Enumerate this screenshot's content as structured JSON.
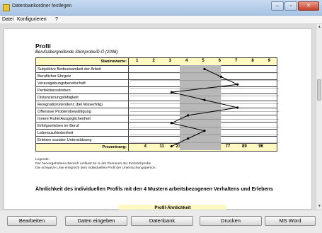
{
  "window": {
    "title": "Datenbankordner festlegen",
    "controls": [
      "–",
      "▫",
      "✕"
    ]
  },
  "menu": [
    "Datei",
    "Konfigurieren",
    "?"
  ],
  "report": {
    "heading": "Profil",
    "subheading": "Berufsübergreifende Stichprobe/D-Ö (2008)",
    "stanine_label": "Staninewerte:",
    "stanine_values": [
      "1",
      "2",
      "3",
      "4",
      "5",
      "6",
      "7",
      "8",
      "9"
    ],
    "percentile_label": "Prozentrang:",
    "percentile_values": [
      "4",
      "11",
      "23",
      "40",
      "60",
      "77",
      "89",
      "96"
    ],
    "rows": [
      "Subjektive Bedeutsamkeit der Arbeit",
      "Beruflicher Ehrgeiz",
      "Verausgabungsbereitschaft",
      "Perfektionsstreben",
      "Distanzierungsfähigkeit",
      "Resignationstendenz (bei Misserfolg)",
      "Offensive Problembewältigung",
      "Innere Ruhe/Ausgeglichenheit",
      "Erfolgserleben im Beruf",
      "Lebenszufriedenheit",
      "Erleben sozialer Unterstützung"
    ],
    "legend": [
      "Legende:",
      "Der hervorgehobene Bereich umfasst 54 % der Personen der Eichstichprobe.",
      "Die schwarze Linie entspricht dem individuellen Profil der Untersuchungsperson."
    ],
    "similarity_heading": "Ähnlichkeit des individuellen Profils mit den 4 Mustern arbeitsbezogenen Verhaltens und Erlebens",
    "similarity_box": "Profil-Ähnlichkeit"
  },
  "chart_data": {
    "type": "line",
    "title": "Profil",
    "x_scale": "Stanine 1–9",
    "highlight_band": [
      4,
      6.5
    ],
    "categories": [
      "Subjektive Bedeutsamkeit der Arbeit",
      "Beruflicher Ehrgeiz",
      "Verausgabungsbereitschaft",
      "Perfektionsstreben",
      "Distanzierungsfähigkeit",
      "Resignationstendenz (bei Misserfolg)",
      "Offensive Problembewältigung",
      "Innere Ruhe/Ausgeglichenheit",
      "Erfolgserleben im Beruf",
      "Lebenszufriedenheit",
      "Erleben sozialer Unterstützung"
    ],
    "values": [
      5,
      6,
      7,
      3,
      5,
      7,
      4,
      3,
      5,
      4,
      3
    ]
  },
  "buttons": [
    "Bearbeiten",
    "Daten eingeben",
    "Datenbank",
    "Drucken",
    "MS Word"
  ],
  "colors": {
    "band": "#b8b8b8",
    "scale_bg": "#fff8c0",
    "titlebar": "#b9cfeb"
  }
}
